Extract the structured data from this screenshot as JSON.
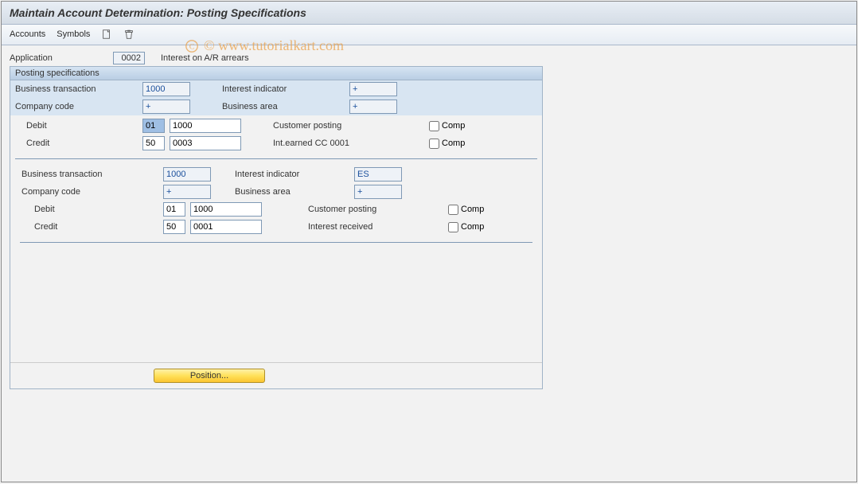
{
  "title": "Maintain Account Determination: Posting Specifications",
  "watermark": "© www.tutorialkart.com",
  "toolbar": {
    "accounts": "Accounts",
    "symbols": "Symbols"
  },
  "application": {
    "label": "Application",
    "code": "0002",
    "desc": "Interest on A/R arrears"
  },
  "group_title": "Posting specifications",
  "labels": {
    "business_transaction": "Business transaction",
    "interest_indicator": "Interest indicator",
    "company_code": "Company code",
    "business_area": "Business area",
    "debit": "Debit",
    "credit": "Credit",
    "comp": "Comp"
  },
  "block1": {
    "business_transaction": "1000",
    "interest_indicator": "+",
    "company_code": "+",
    "business_area": "+",
    "debit": {
      "posting_key": "01",
      "acct_sym": "1000",
      "desc": "Customer posting",
      "comp": false
    },
    "credit": {
      "posting_key": "50",
      "acct_sym": "0003",
      "desc": "Int.earned CC 0001",
      "comp": false
    }
  },
  "block2": {
    "business_transaction": "1000",
    "interest_indicator": "ES",
    "company_code": "+",
    "business_area": "+",
    "debit": {
      "posting_key": "01",
      "acct_sym": "1000",
      "desc": "Customer posting",
      "comp": false
    },
    "credit": {
      "posting_key": "50",
      "acct_sym": "0001",
      "desc": "Interest received",
      "comp": false
    }
  },
  "buttons": {
    "position": "Position..."
  }
}
